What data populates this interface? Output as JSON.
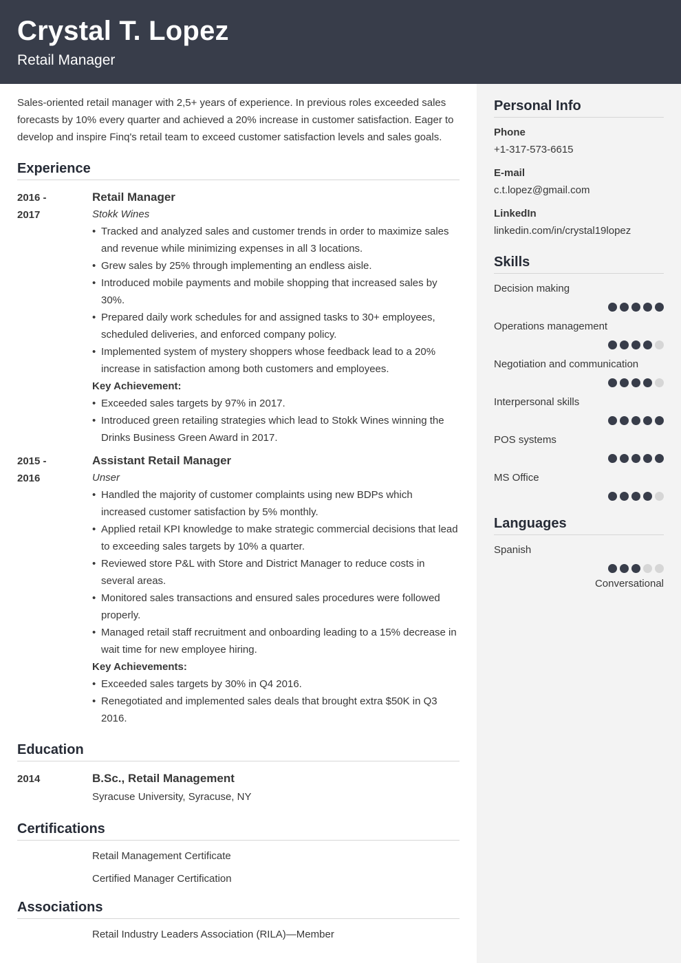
{
  "header": {
    "name": "Crystal T. Lopez",
    "title": "Retail Manager"
  },
  "summary": "Sales-oriented retail manager with 2,5+ years of experience. In previous roles exceeded sales forecasts by 10% every quarter and achieved a 20% increase in customer satisfaction. Eager to develop and inspire Finq's retail team to exceed customer satisfaction levels and sales goals.",
  "experience": {
    "title": "Experience",
    "entries": [
      {
        "date_start": "2016 -",
        "date_end": "2017",
        "role": "Retail Manager",
        "company": "Stokk Wines",
        "bullets": [
          "Tracked and analyzed sales and customer trends in order to maximize sales and revenue while minimizing expenses in all 3 locations.",
          "Grew sales by 25% through implementing an endless aisle.",
          "Introduced mobile payments and mobile shopping that increased sales by 30%.",
          "Prepared daily work schedules for and assigned tasks to 30+ employees, scheduled deliveries, and enforced company policy.",
          "Implemented system of mystery shoppers whose feedback lead to a 20% increase in satisfaction among both customers and employees."
        ],
        "key_label": "Key Achievement:",
        "achievements": [
          "Exceeded sales targets by 97% in 2017.",
          "Introduced green retailing strategies which lead to Stokk Wines winning the Drinks Business Green Award in 2017."
        ]
      },
      {
        "date_start": "2015 -",
        "date_end": "2016",
        "role": "Assistant Retail Manager",
        "company": "Unser",
        "bullets": [
          "Handled the majority of customer complaints using new BDPs which increased customer satisfaction by 5% monthly.",
          "Applied retail KPI knowledge to make strategic commercial decisions that lead to exceeding sales targets by 10% a quarter.",
          "Reviewed store P&L with Store and District Manager to reduce costs in several areas.",
          "Monitored sales transactions and ensured sales procedures were followed properly.",
          "Managed retail staff recruitment and onboarding leading to a 15% decrease in wait time for new employee hiring."
        ],
        "key_label": "Key Achievements:",
        "achievements": [
          "Exceeded sales targets by 30% in Q4 2016.",
          "Renegotiated and implemented sales deals that brought extra $50K in Q3 2016."
        ]
      }
    ]
  },
  "education": {
    "title": "Education",
    "entries": [
      {
        "date": "2014",
        "degree": "B.Sc., Retail Management",
        "school": "Syracuse University, Syracuse, NY"
      }
    ]
  },
  "certifications": {
    "title": "Certifications",
    "items": [
      "Retail Management Certificate",
      "Certified Manager Certification"
    ]
  },
  "associations": {
    "title": "Associations",
    "items": [
      "Retail Industry Leaders Association (RILA)—Member"
    ]
  },
  "personal_info": {
    "title": "Personal Info",
    "phone_label": "Phone",
    "phone": "+1-317-573-6615",
    "email_label": "E-mail",
    "email": "c.t.lopez@gmail.com",
    "linkedin_label": "LinkedIn",
    "linkedin": "linkedin.com/in/crystal19lopez"
  },
  "skills": {
    "title": "Skills",
    "max": 5,
    "items": [
      {
        "label": "Decision making",
        "level": 5
      },
      {
        "label": "Operations management",
        "level": 4
      },
      {
        "label": "Negotiation and communication",
        "level": 4
      },
      {
        "label": "Interpersonal skills",
        "level": 5
      },
      {
        "label": "POS systems",
        "level": 5
      },
      {
        "label": "MS Office",
        "level": 4
      }
    ]
  },
  "languages": {
    "title": "Languages",
    "max": 5,
    "items": [
      {
        "label": "Spanish",
        "level": 3,
        "level_text": "Conversational"
      }
    ]
  },
  "colors": {
    "header_bg": "#383d4a",
    "sidebar_bg": "#f3f3f3",
    "dot_filled": "#383d4a",
    "dot_empty": "#d6d6d6"
  }
}
